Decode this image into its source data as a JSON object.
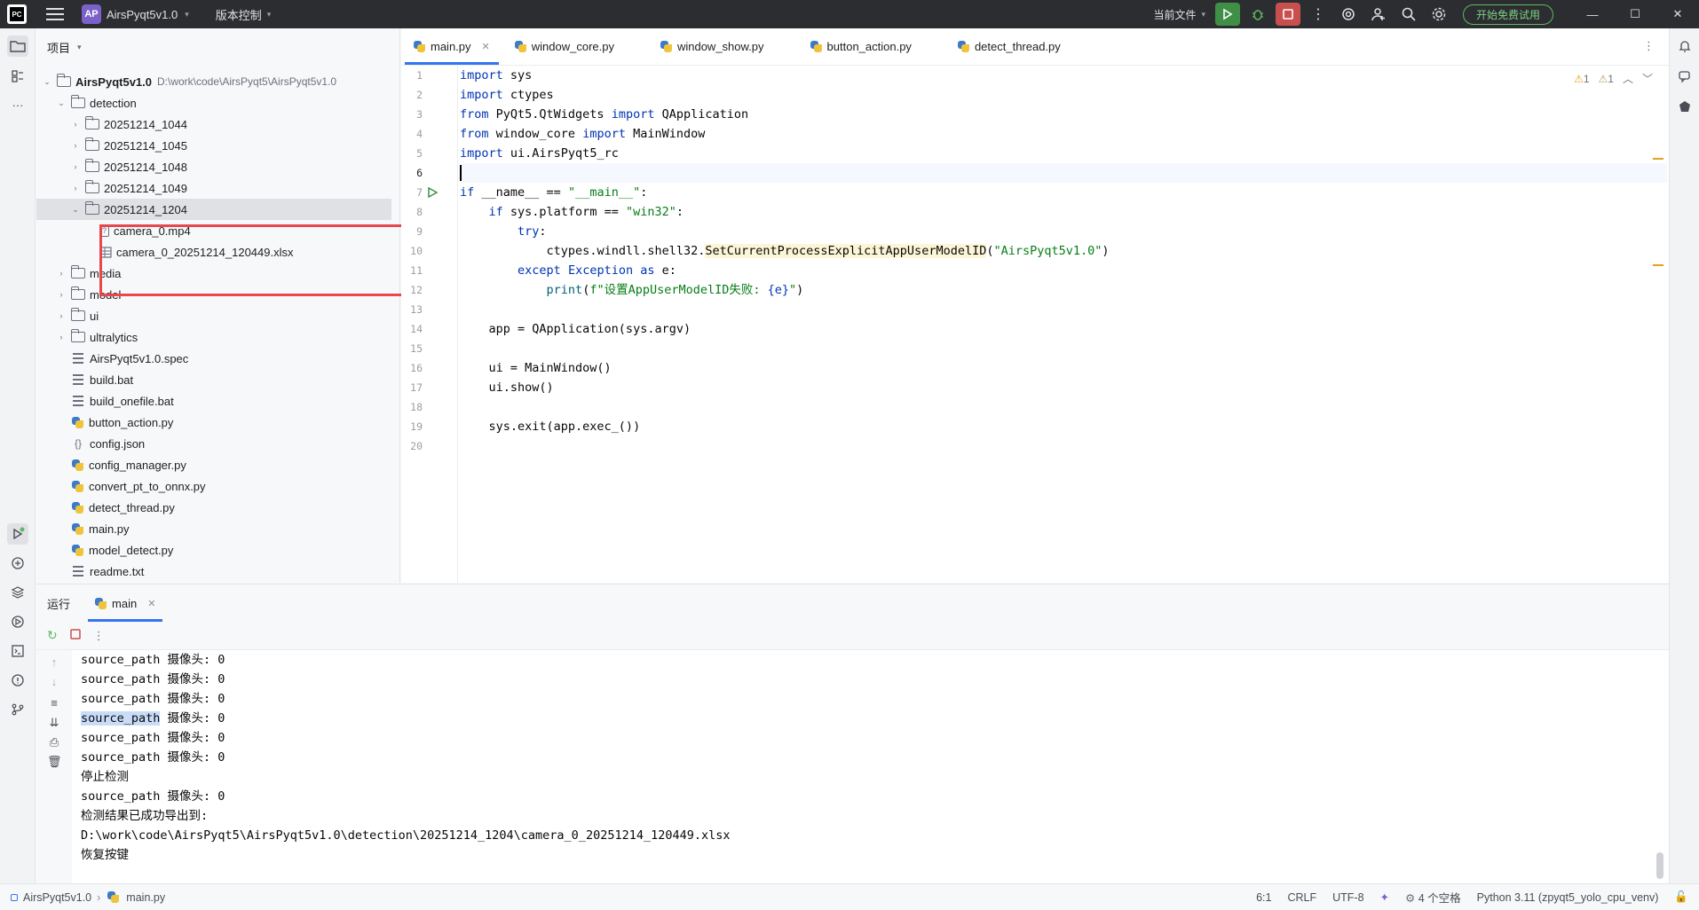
{
  "titlebar": {
    "project_badge": "AP",
    "project_name": "AirsPyqt5v1.0",
    "vcs_label": "版本控制",
    "current_file": "当前文件",
    "trial_button": "开始免费试用"
  },
  "project_panel": {
    "title": "项目",
    "root": {
      "name": "AirsPyqt5v1.0",
      "path": "D:\\work\\code\\AirsPyqt5\\AirsPyqt5v1.0"
    },
    "items": [
      {
        "label": "detection"
      },
      {
        "label": "20251214_1044"
      },
      {
        "label": "20251214_1045"
      },
      {
        "label": "20251214_1048"
      },
      {
        "label": "20251214_1049"
      },
      {
        "label": "20251214_1204"
      },
      {
        "label": "camera_0.mp4"
      },
      {
        "label": "camera_0_20251214_120449.xlsx"
      },
      {
        "label": "media"
      },
      {
        "label": "model"
      },
      {
        "label": "ui"
      },
      {
        "label": "ultralytics"
      },
      {
        "label": "AirsPyqt5v1.0.spec"
      },
      {
        "label": "build.bat"
      },
      {
        "label": "build_onefile.bat"
      },
      {
        "label": "button_action.py"
      },
      {
        "label": "config.json"
      },
      {
        "label": "config_manager.py"
      },
      {
        "label": "convert_pt_to_onnx.py"
      },
      {
        "label": "detect_thread.py"
      },
      {
        "label": "main.py"
      },
      {
        "label": "model_detect.py"
      },
      {
        "label": "readme.txt"
      }
    ]
  },
  "editor": {
    "tabs": [
      {
        "label": "main.py"
      },
      {
        "label": "window_core.py"
      },
      {
        "label": "window_show.py"
      },
      {
        "label": "button_action.py"
      },
      {
        "label": "detect_thread.py"
      }
    ],
    "line_numbers": [
      "1",
      "2",
      "3",
      "4",
      "5",
      "6",
      "7",
      "8",
      "9",
      "10",
      "11",
      "12",
      "13",
      "14",
      "15",
      "16",
      "17",
      "18",
      "19",
      "20"
    ],
    "warnings": {
      "count1": "1",
      "count2": "1"
    },
    "code": {
      "l1_kw": "import",
      "l1_rest": " sys",
      "l2_kw": "import",
      "l2_rest": " ctypes",
      "l3_kw1": "from",
      "l3_mid": " PyQt5.QtWidgets ",
      "l3_kw2": "import",
      "l3_rest": " QApplication",
      "l4_kw1": "from",
      "l4_mid": " window_core ",
      "l4_kw2": "import",
      "l4_rest": " MainWindow",
      "l5_kw": "import",
      "l5_rest": " ui.AirsPyqt5_rc",
      "l7_kw": "if",
      "l7_mid": " __name__ == ",
      "l7_str": "\"__main__\"",
      "l7_end": ":",
      "l8_indent": "    ",
      "l8_kw": "if",
      "l8_mid": " sys.platform == ",
      "l8_str": "\"win32\"",
      "l8_end": ":",
      "l9_indent": "        ",
      "l9_kw": "try",
      "l9_end": ":",
      "l10_indent": "            ",
      "l10_mid": "ctypes.windll.shell32.",
      "l10_fn": "SetCurrentProcessExplicitAppUserModelID",
      "l10_p1": "(",
      "l10_str": "\"AirsPyqt5v1.0\"",
      "l10_p2": ")",
      "l11_indent": "        ",
      "l11_kw": "except",
      "l11_mid": " Exception ",
      "l11_kw2": "as",
      "l11_end": " e:",
      "l12_indent": "            ",
      "l12_fn": "print",
      "l12_p1": "(",
      "l12_str": "f\"设置AppUserModelID失败: ",
      "l12_var": "{e}",
      "l12_str2": "\"",
      "l12_p2": ")",
      "l14": "    app = QApplication(sys.argv)",
      "l16": "    ui = MainWindow()",
      "l17": "    ui.show()",
      "l19": "    sys.exit(app.exec_())"
    }
  },
  "run_panel": {
    "title": "运行",
    "tab_label": "main",
    "lines": [
      "source_path 摄像头: 0",
      "source_path 摄像头: 0",
      "source_path 摄像头: 0",
      "source_path 摄像头: 0",
      "source_path 摄像头: 0",
      "source_path 摄像头: 0",
      "停止检测",
      "source_path 摄像头: 0",
      "检测结果已成功导出到:",
      "D:\\work\\code\\AirsPyqt5\\AirsPyqt5v1.0\\detection\\20251214_1204\\camera_0_20251214_120449.xlsx",
      "恢复按键"
    ],
    "highlight_word": "source_path",
    "highlight_rest": " 摄像头: 0"
  },
  "statusbar": {
    "breadcrumb_project": "AirsPyqt5v1.0",
    "breadcrumb_file": "main.py",
    "position": "6:1",
    "line_sep": "CRLF",
    "encoding": "UTF-8",
    "indent": "4 个空格",
    "interpreter": "Python 3.11 (zpyqt5_yolo_cpu_venv)"
  },
  "colors": {
    "accent": "#3574f0",
    "highlight_box": "#e8474d",
    "run_green": "#3f8f46",
    "stop_red": "#c94f4f"
  }
}
